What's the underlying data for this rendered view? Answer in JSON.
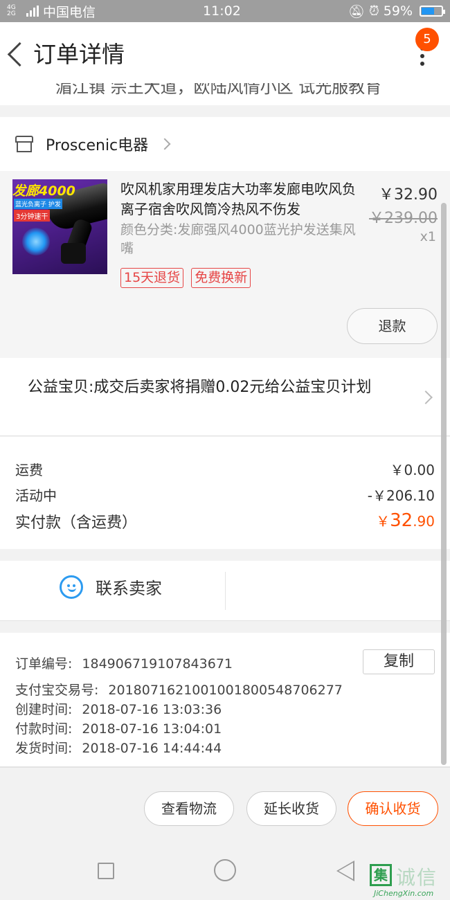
{
  "status_bar": {
    "network_tag": "4G 2G",
    "carrier": "中国电信",
    "time": "11:02",
    "battery": "59%",
    "battery_level": 0.59
  },
  "header": {
    "title": "订单详情",
    "badge_count": "5"
  },
  "address_partial": "湄江镇 宗王大道，欧陆风情小区 试光服教育",
  "shop": {
    "name": "Proscenic电器"
  },
  "product": {
    "title": "吹风机家用理发店大功率发廊电吹风负离子宿舍吹风筒冷热风不伤发",
    "sku": "颜色分类:发廊强风4000蓝光护发送集风嘴",
    "price": "￥32.90",
    "original_price": "￥239.00",
    "quantity": "x1",
    "tags": [
      "15天退货",
      "免费换新"
    ],
    "refund_label": "退款",
    "thumbnail_text": {
      "headline": "发廊4000",
      "sub": "蓝光负离子 护发",
      "speed": "3分钟速干"
    }
  },
  "charity": {
    "text": "公益宝贝:成交后卖家将捐赠0.02元给公益宝贝计划"
  },
  "fees": [
    {
      "label": "运费",
      "value": "￥0.00"
    },
    {
      "label": "活动中",
      "value": "-￥206.10"
    }
  ],
  "paid": {
    "label": "实付款（含运费）",
    "currency": "￥",
    "integer": "32",
    "decimal": ".90"
  },
  "contact": {
    "label": "联系卖家"
  },
  "order_info": {
    "order_no_label": "订单编号:",
    "order_no": "184906719107843671",
    "copy_label": "复制",
    "alipay_label": "支付宝交易号:",
    "alipay_no": "2018071621001001800548706277",
    "created_label": "创建时间:",
    "created": "2018-07-16 13:03:36",
    "paid_label": "付款时间:",
    "paid_time": "2018-07-16 13:04:01",
    "shipped_label": "发货时间:",
    "shipped": "2018-07-16 14:44:44"
  },
  "actions": {
    "logistics": "查看物流",
    "extend": "延长收货",
    "confirm": "确认收货"
  },
  "watermark": {
    "mark": "集",
    "text": "诚信",
    "domain": "JiChengXin.com"
  },
  "colors": {
    "accent": "#ff5000",
    "tag_red": "#e64545",
    "wangwang_blue": "#2d9bf0"
  }
}
